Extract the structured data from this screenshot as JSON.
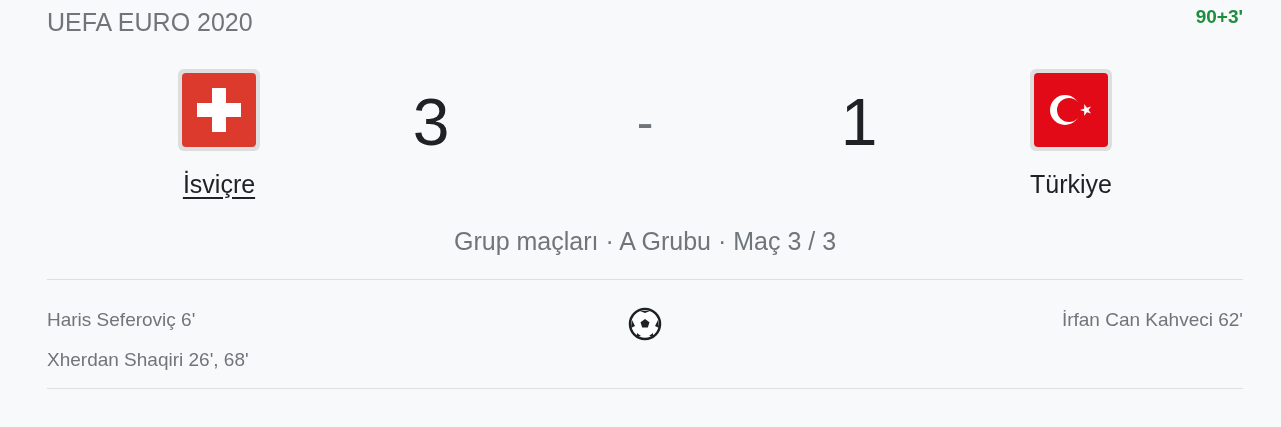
{
  "competition": "UEFA EURO 2020",
  "status": "90+3'",
  "home": {
    "name": "İsviçre",
    "score": "3",
    "kind": "switzerland",
    "link": true
  },
  "away": {
    "name": "Türkiye",
    "score": "1",
    "kind": "turkey",
    "link": false
  },
  "separator": "-",
  "stage": "Grup maçları · A Grubu · Maç 3 / 3",
  "home_goals": [
    "Haris Seferoviç 6'",
    "Xherdan Shaqiri 26', 68'"
  ],
  "away_goals": [
    "İrfan Can Kahveci 62'"
  ]
}
